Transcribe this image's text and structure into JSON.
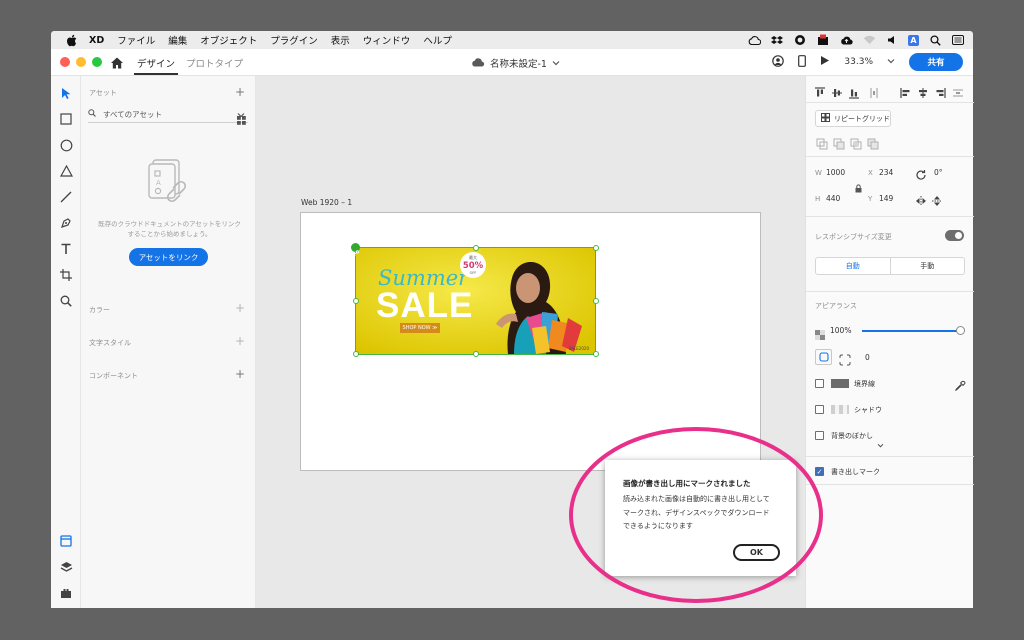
{
  "menubar": {
    "items": [
      "XD",
      "ファイル",
      "編集",
      "オブジェクト",
      "プラグイン",
      "表示",
      "ウィンドウ",
      "ヘルプ"
    ],
    "tray_icons": [
      "creative-cloud-icon",
      "dropbox-icon",
      "cc-sync-icon",
      "screenshot-icon",
      "cloud-upload-icon",
      "wifi-icon",
      "volume-icon",
      "input-source-icon",
      "search-icon",
      "menu-extras-icon"
    ],
    "input_source_label": "A"
  },
  "titlebar": {
    "tab_design": "デザイン",
    "tab_prototype": "プロトタイプ",
    "doc_title": "名称未設定-1",
    "zoom": "33.3%",
    "share_label": "共有"
  },
  "tools": [
    "select-tool-icon",
    "rectangle-tool-icon",
    "ellipse-tool-icon",
    "polygon-tool-icon",
    "line-tool-icon",
    "pen-tool-icon",
    "text-tool-icon",
    "artboard-tool-icon",
    "zoom-tool-icon",
    "assets-panel-icon",
    "layers-panel-icon",
    "plugins-panel-icon"
  ],
  "assets_panel": {
    "title": "アセット",
    "search_label": "すべてのアセット",
    "message": "既存のクラウドドキュメントのアセットをリンクすることから始めましょう。",
    "link_button": "アセットをリンク",
    "sections": [
      "カラー",
      "文字スタイル",
      "コンポーネント"
    ]
  },
  "canvas": {
    "artboard_label": "Web 1920 – 1",
    "banner": {
      "script_text": "Summer",
      "headline": "SALE",
      "cta": "SHOP NOW ≫",
      "badge_top": "最大",
      "badge_value": "50%",
      "badge_bottom": "OFF",
      "code": "SALE2020"
    }
  },
  "props": {
    "repeat_grid": "リピートグリッド",
    "w_label": "W",
    "w_value": "1000",
    "x_label": "X",
    "x_value": "234",
    "rotation_value": "0°",
    "h_label": "H",
    "h_value": "440",
    "y_label": "Y",
    "y_value": "149",
    "responsive_label": "レスポンシブサイズ変更",
    "responsive_on": true,
    "auto_label": "自動",
    "manual_label": "手動",
    "appearance_label": "アピアランス",
    "opacity_value": "100%",
    "opacity_fraction": 1.0,
    "corner_value": "0",
    "border_label": "境界線",
    "shadow_label": "シャドウ",
    "bg_blur_label": "背景のぼかし",
    "export_mark_label": "書き出しマーク",
    "export_mark_checked": true
  },
  "dialog": {
    "title": "画像が書き出し用にマークされました",
    "line1": "読み込まれた画像は自動的に書き出し用として",
    "line2": "マークされ、デザインスペックでダウンロード",
    "line3": "できるようになります",
    "ok_label": "OK"
  },
  "colors": {
    "accent": "#1473e6",
    "selection": "#42b642",
    "banner_bg": "#ead500",
    "highlight_ring": "#e8308a"
  }
}
